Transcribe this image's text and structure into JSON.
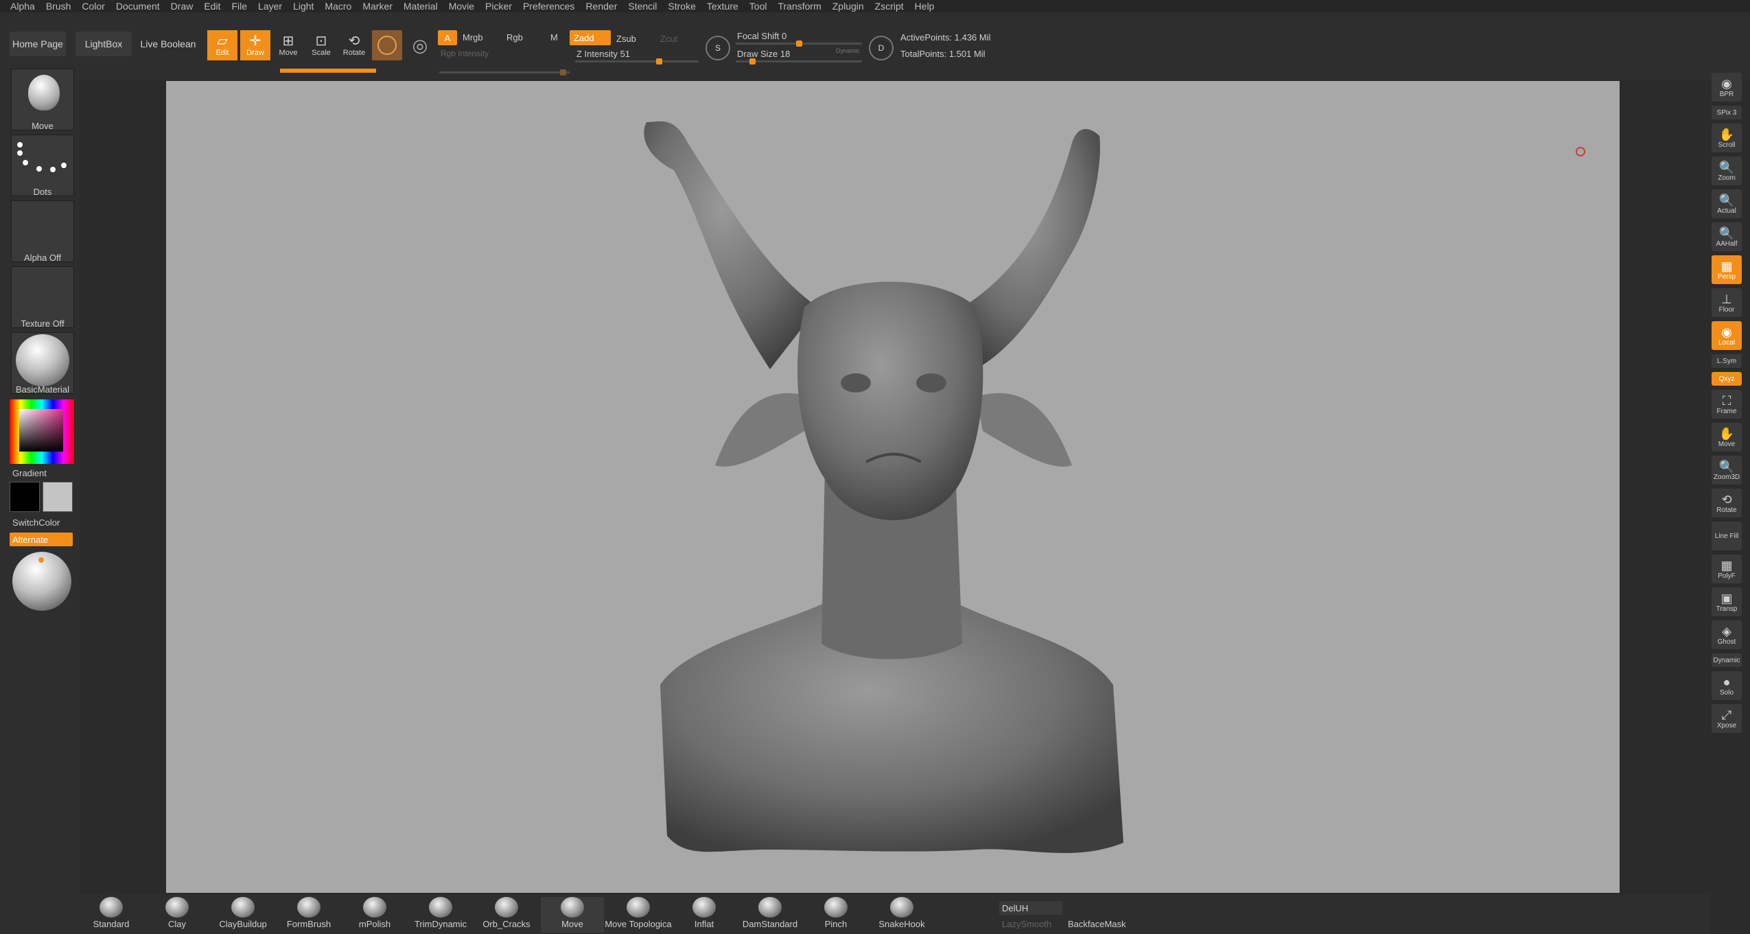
{
  "menu": [
    "Alpha",
    "Brush",
    "Color",
    "Document",
    "Draw",
    "Edit",
    "File",
    "Layer",
    "Light",
    "Macro",
    "Marker",
    "Material",
    "Movie",
    "Picker",
    "Preferences",
    "Render",
    "Stencil",
    "Stroke",
    "Texture",
    "Tool",
    "Transform",
    "Zplugin",
    "Zscript",
    "Help"
  ],
  "shelf": {
    "home": "Home Page",
    "lightbox": "LightBox",
    "liveboolean": "Live Boolean",
    "edit": "Edit",
    "draw": "Draw",
    "move": "Move",
    "scale": "Scale",
    "rotate": "Rotate",
    "a": "A",
    "mrgb": "Mrgb",
    "rgb": "Rgb",
    "m": "M",
    "rgb_intensity": "Rgb Intensity",
    "zadd": "Zadd",
    "zsub": "Zsub",
    "zcut": "Zcut",
    "z_intensity": "Z Intensity 51",
    "focal_shift": "Focal Shift 0",
    "draw_size": "Draw Size 18",
    "dynamic": "Dynamic",
    "s": "S",
    "d": "D",
    "active_points": "ActivePoints: 1.436 Mil",
    "total_points": "TotalPoints: 1.501 Mil"
  },
  "left": {
    "brush": "Move",
    "stroke": "Dots",
    "alpha": "Alpha Off",
    "texture": "Texture Off",
    "material": "BasicMaterial",
    "gradient": "Gradient",
    "switchcolor": "SwitchColor",
    "alternate": "Alternate"
  },
  "right": [
    {
      "id": "bpr",
      "label": "BPR"
    },
    {
      "id": "spix",
      "label": "SPix 3"
    },
    {
      "id": "scroll",
      "label": "Scroll"
    },
    {
      "id": "zoom",
      "label": "Zoom"
    },
    {
      "id": "actual",
      "label": "Actual"
    },
    {
      "id": "aahalf",
      "label": "AAHalf"
    },
    {
      "id": "persp",
      "label": "Persp"
    },
    {
      "id": "floor",
      "label": "Floor"
    },
    {
      "id": "local",
      "label": "Local"
    },
    {
      "id": "lsym",
      "label": "L.Sym"
    },
    {
      "id": "xyz",
      "label": "Qxyz"
    },
    {
      "id": "frame",
      "label": "Frame"
    },
    {
      "id": "move",
      "label": "Move"
    },
    {
      "id": "zoom3d",
      "label": "Zoom3D"
    },
    {
      "id": "rotate",
      "label": "Rotate"
    },
    {
      "id": "linefill",
      "label": "Line Fill"
    },
    {
      "id": "polyf",
      "label": "PolyF"
    },
    {
      "id": "transp",
      "label": "Transp"
    },
    {
      "id": "ghost",
      "label": "Ghost"
    },
    {
      "id": "dynamic",
      "label": "Dynamic"
    },
    {
      "id": "solo",
      "label": "Solo"
    },
    {
      "id": "xpose",
      "label": "Xpose"
    }
  ],
  "brushes": [
    "Standard",
    "Clay",
    "ClayBuildup",
    "FormBrush",
    "mPolish",
    "TrimDynamic",
    "Orb_Cracks",
    "Move",
    "Move Topologica",
    "Inflat",
    "DamStandard",
    "Pinch",
    "SnakeHook"
  ],
  "bottom": {
    "deluh": "DelUH",
    "lazysmooth": "LazySmooth",
    "backfacemask": "BackfaceMask"
  },
  "colors": {
    "accent": "#f28f1a",
    "panel": "#2e2e2e",
    "canvas": "#a8a8a8"
  }
}
